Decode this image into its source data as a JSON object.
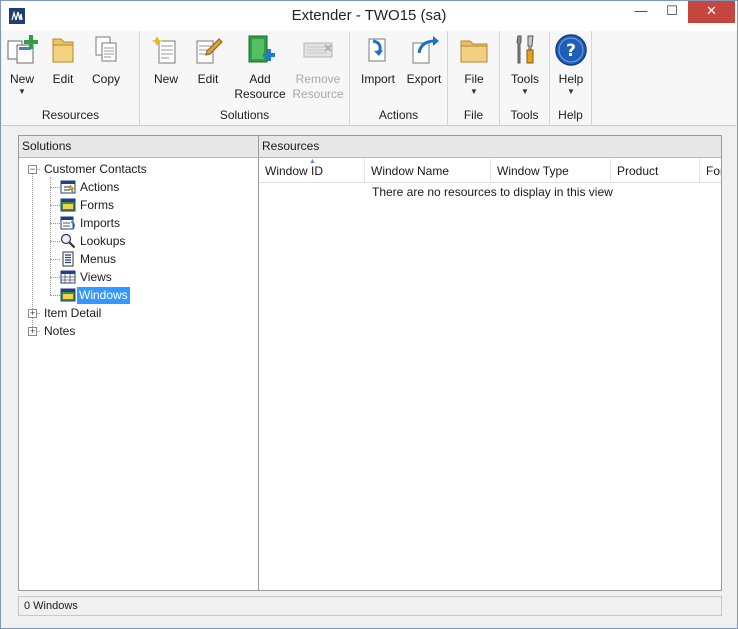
{
  "window": {
    "title": "Extender  -  TWO15 (sa)",
    "min_glyph": "—",
    "max_glyph": "☐",
    "close_glyph": "✕"
  },
  "ribbon": {
    "groups": [
      {
        "label": "Resources",
        "buttons": [
          {
            "label": "New",
            "icon": "new-resource-icon",
            "dropdown": true
          },
          {
            "label": "Edit",
            "icon": "folder-edit-icon"
          },
          {
            "label": "Copy",
            "icon": "copy-icon"
          }
        ]
      },
      {
        "label": "Solutions",
        "buttons": [
          {
            "label": "New",
            "icon": "new-solution-icon"
          },
          {
            "label": "Edit",
            "icon": "edit-solution-icon"
          },
          {
            "label": "Add Resource",
            "line1": "Add",
            "line2": "Resource",
            "icon": "add-resource-icon"
          },
          {
            "label": "Remove Resource",
            "line1": "Remove",
            "line2": "Resource",
            "icon": "remove-resource-icon",
            "disabled": true
          }
        ]
      },
      {
        "label": "Actions",
        "buttons": [
          {
            "label": "Import",
            "icon": "import-icon"
          },
          {
            "label": "Export",
            "icon": "export-icon"
          }
        ]
      },
      {
        "label": "File",
        "buttons": [
          {
            "label": "File",
            "icon": "folder-icon",
            "dropdown": true
          }
        ]
      },
      {
        "label": "Tools",
        "buttons": [
          {
            "label": "Tools",
            "icon": "tools-icon",
            "dropdown": true
          }
        ]
      },
      {
        "label": "Help",
        "buttons": [
          {
            "label": "Help",
            "icon": "help-icon",
            "dropdown": true
          }
        ]
      }
    ],
    "dropdown_glyph": "▼"
  },
  "solutions": {
    "header": "Solutions",
    "tree": [
      {
        "label": "Customer Contacts",
        "expanded": true,
        "expander": "−",
        "children": [
          {
            "label": "Actions",
            "icon": "actions-icon"
          },
          {
            "label": "Forms",
            "icon": "forms-icon"
          },
          {
            "label": "Imports",
            "icon": "imports-icon"
          },
          {
            "label": "Lookups",
            "icon": "lookups-icon"
          },
          {
            "label": "Menus",
            "icon": "menus-icon"
          },
          {
            "label": "Views",
            "icon": "views-icon"
          },
          {
            "label": "Windows",
            "icon": "windows-icon",
            "selected": true
          }
        ]
      },
      {
        "label": "Item Detail",
        "expanded": false,
        "expander": "+"
      },
      {
        "label": "Notes",
        "expanded": false,
        "expander": "+"
      }
    ]
  },
  "resources": {
    "header": "Resources",
    "columns": [
      "Window ID",
      "Window Name",
      "Window Type",
      "Product",
      "Form"
    ],
    "sort_glyph": "▲",
    "empty_message": "There are no resources to display in this view"
  },
  "status": {
    "text": "0 Windows"
  },
  "colors": {
    "selection": "#3399ff",
    "close_button": "#c7453f",
    "help_blue": "#1f5fb8",
    "add_green": "#2e9e3e"
  }
}
